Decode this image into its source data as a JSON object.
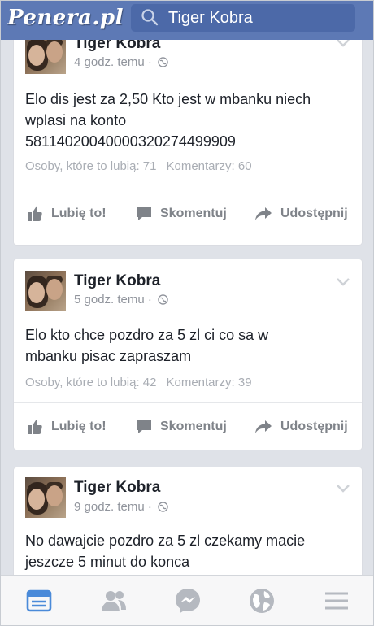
{
  "watermark": "Penera.pl",
  "search": {
    "text": "Tiger Kobra"
  },
  "posts": [
    {
      "author": "Tiger Kobra",
      "time": "4 godz. temu · ",
      "lines": [
        "Elo dis jest za 2,50 Kto jest w mbanku  niech",
        "wplasi na konto",
        "58114020040000320274499909"
      ],
      "likes": "Osoby, które to lubią: 71",
      "comments": "Komentarzy: 60",
      "actions": {
        "like": "Lubię to!",
        "comment": "Skomentuj",
        "share": "Udostępnij"
      }
    },
    {
      "author": "Tiger Kobra",
      "time": "5 godz. temu · ",
      "lines": [
        "Elo kto chce pozdro za 5 zl ci co sa w",
        "mbanku pisac zapraszam"
      ],
      "likes": "Osoby, które to lubią: 42",
      "comments": "Komentarzy: 39",
      "actions": {
        "like": "Lubię to!",
        "comment": "Skomentuj",
        "share": "Udostępnij"
      }
    },
    {
      "author": "Tiger Kobra",
      "time": "9 godz. temu · ",
      "lines": [
        "No dawajcie pozdro za 5 zl czekamy macie",
        "jeszcze 5 minut do konca"
      ]
    }
  ],
  "tabs": [
    "news-feed-icon",
    "friends-icon",
    "messenger-icon",
    "globe-icon",
    "menu-icon"
  ],
  "colors": {
    "brand": "#5d79b5",
    "active_tab": "#4a8ad9",
    "inactive_tab": "#b5b9c0"
  }
}
